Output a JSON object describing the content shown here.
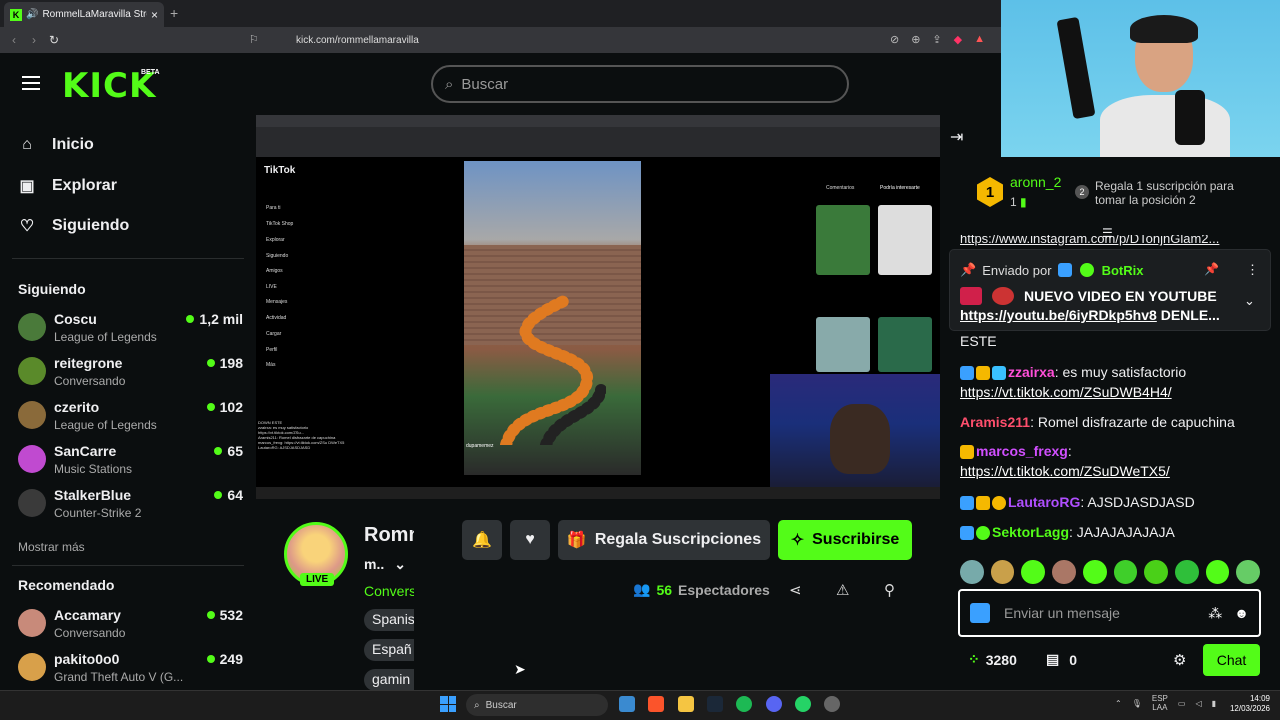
{
  "browser": {
    "tab_title": "RommelLaMaravilla Stream",
    "url": "kick.com/rommellamaravilla"
  },
  "site": {
    "logo": "KICK",
    "beta": "BETA",
    "search_placeholder": "Buscar"
  },
  "nav": {
    "home": "Inicio",
    "explore": "Explorar",
    "following": "Siguiendo"
  },
  "following": {
    "header": "Siguiendo",
    "items": [
      {
        "name": "Coscu",
        "category": "League of Legends",
        "viewers": "1,2 mil"
      },
      {
        "name": "reitegrone",
        "category": "Conversando",
        "viewers": "198"
      },
      {
        "name": "czerito",
        "category": "League of Legends",
        "viewers": "102"
      },
      {
        "name": "SanCarre",
        "category": "Music Stations",
        "viewers": "65"
      },
      {
        "name": "StalkerBlue",
        "category": "Counter-Strike 2",
        "viewers": "64"
      }
    ],
    "show_more": "Mostrar más"
  },
  "recommended": {
    "header": "Recomendado",
    "items": [
      {
        "name": "Accamary",
        "category": "Conversando",
        "viewers": "532"
      },
      {
        "name": "pakito0o0",
        "category": "Grand Theft Auto V (G...",
        "viewers": "249"
      }
    ]
  },
  "video": {
    "tiktok_label": "TikTok",
    "tiktok_nav": [
      "Para ti",
      "TikTok Shop",
      "Explorar",
      "Siguiendo",
      "Amigos",
      "LIVE",
      "Mensajes",
      "Actividad",
      "Cargar",
      "Perfil",
      "Más"
    ],
    "tiktok_tabs": [
      "Comentarios",
      "Podría interesarte"
    ],
    "clip_user": "dupamemez",
    "overlay_chat": "DOWN ESTE\nzzairxa: es muy satisfactorio\nhttps://vt.tiktok.com/ZSu...\nAramis211: Romel disfrazarte de capuchina\nmarcos_frexg: https://vt.tiktok.com/ZSu DWeTX5\nLautaroRG: AJSDJASDJASD"
  },
  "streamer": {
    "name": "Romm",
    "sub_name": "m..",
    "category": "Convers",
    "live_label": "LIVE",
    "tags": [
      "Spanis",
      "Españ",
      "gamin"
    ]
  },
  "actions": {
    "gift_label": "Regala Suscripciones",
    "subscribe_label": "Suscribirse",
    "viewers_count": "56",
    "viewers_label": "Espectadores"
  },
  "chat": {
    "top_gifter": {
      "rank": "1",
      "user": "aronn_2",
      "count": "1",
      "position_badge": "2",
      "prompt": "Regala 1 suscripción para tomar la posición 2"
    },
    "partial_link": "https://www.instagram.com/p/DTonjnGlam2...",
    "pinned": {
      "sent_by_label": "Enviado por",
      "sender": "BotRix",
      "message": "NUEVO VIDEO EN YOUTUBE",
      "link": "https://youtu.be/6iyRDkp5hv8",
      "trail": "DENLE...",
      "overflow": "ESTE"
    },
    "messages": [
      {
        "user": "zzairxa",
        "color": "#ff4fd8",
        "text": ": es muy satisfactorio",
        "link": "https://vt.tiktok.com/ZSuDWB4H4/"
      },
      {
        "user": "Aramis211",
        "color": "#ff4f6d",
        "text": ": Romel disfrazarte de capuchina",
        "link": ""
      },
      {
        "user": "marcos_frexg",
        "color": "#d14fff",
        "text": ":",
        "link": "https://vt.tiktok.com/ZSuDWeTX5/"
      },
      {
        "user": "LautaroRG",
        "color": "#b04fff",
        "text": ": AJSDJASDJASD",
        "link": ""
      },
      {
        "user": "SektorLagg",
        "color": "#53fc18",
        "text": ": JAJAJAJAJAJA",
        "link": ""
      }
    ],
    "input_placeholder": "Enviar un mensaje",
    "points": "3280",
    "box_points": "0",
    "chat_button": "Chat"
  },
  "taskbar": {
    "search": "Buscar",
    "lang": "ESP",
    "lang2": "LAA",
    "time": "14:09",
    "date": "12/03/2026"
  },
  "colors": {
    "accent": "#53fc18",
    "background": "#0b0e0f"
  }
}
